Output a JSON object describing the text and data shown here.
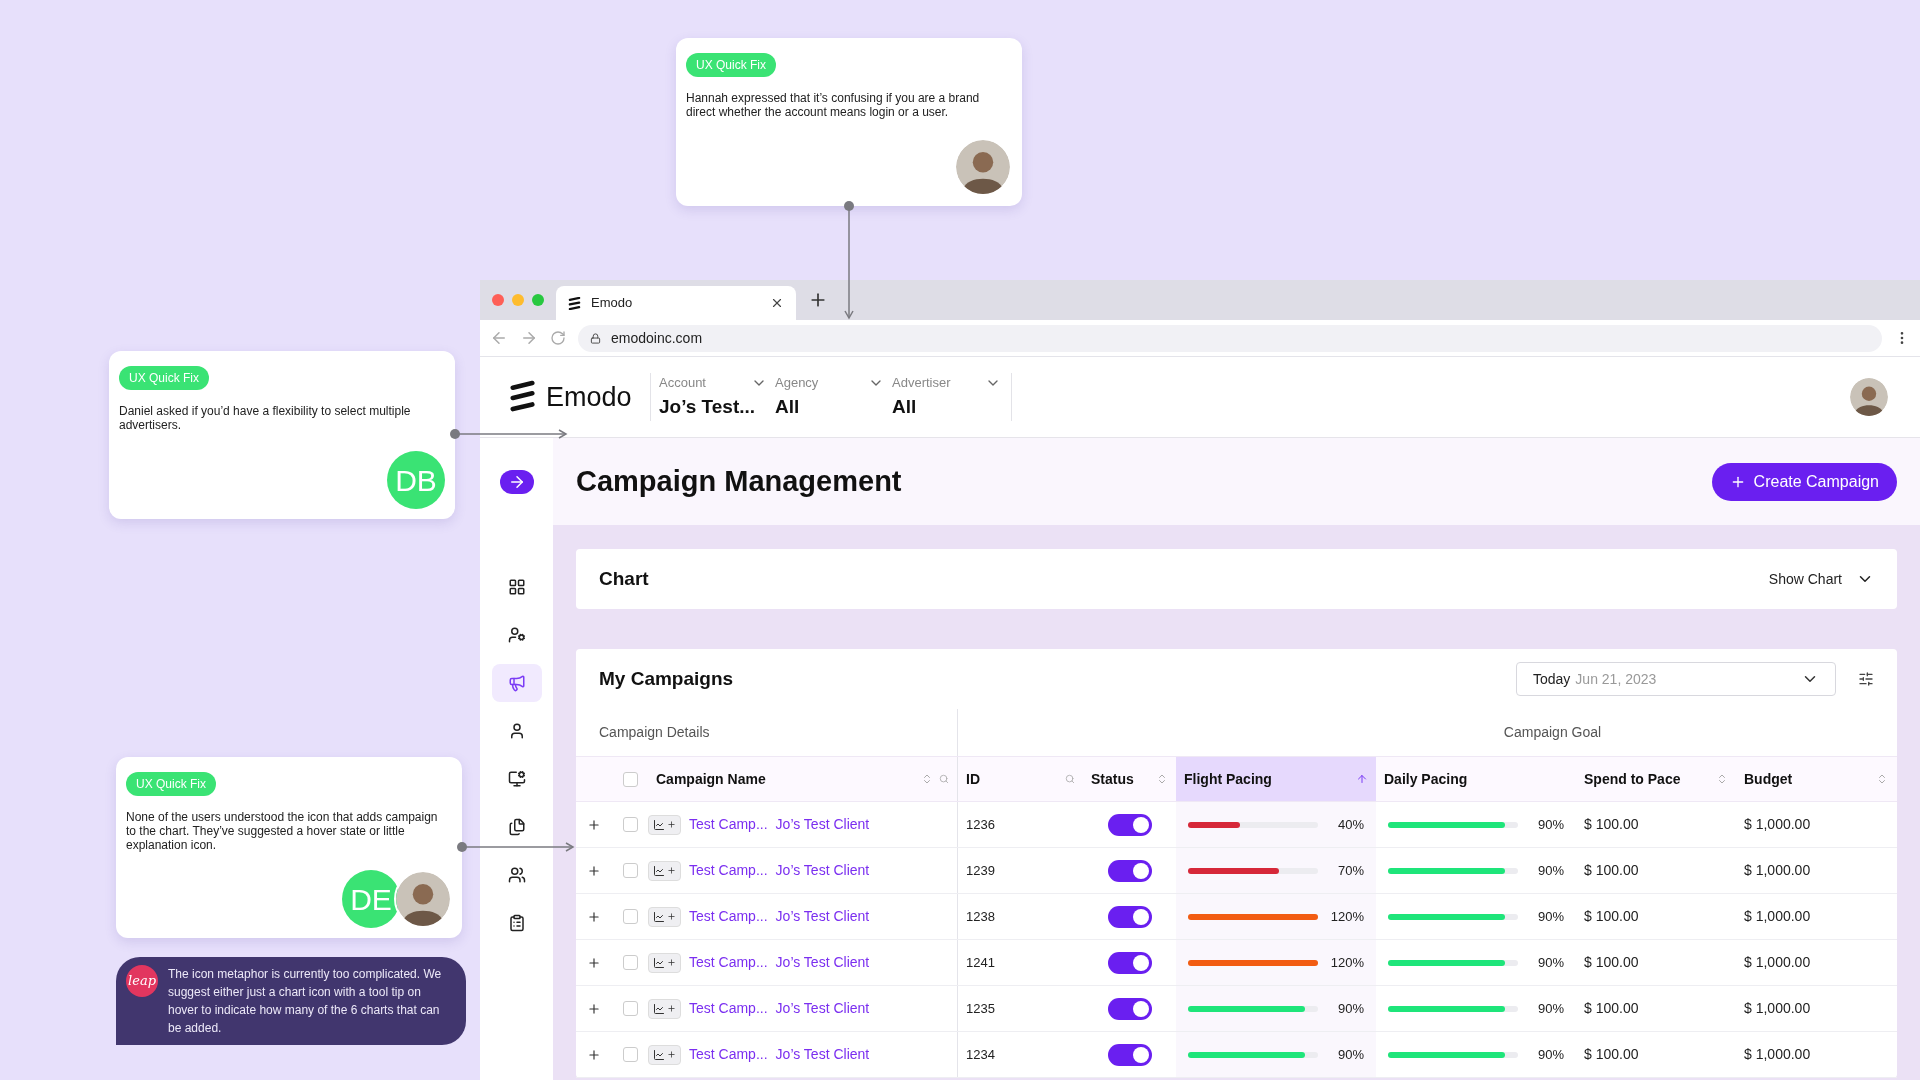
{
  "notes": [
    {
      "kind": "quick_fix",
      "tag": "UX Quick Fix",
      "text": "Hannah expressed that it’s confusing if you are a brand direct whether the account means login or a user.",
      "avatars": [
        {
          "kind": "photo"
        }
      ]
    },
    {
      "kind": "quick_fix",
      "tag": "UX Quick Fix",
      "text": "Daniel asked if you’d have a flexibility to select multiple advertisers.",
      "avatars": [
        {
          "kind": "initials",
          "text": "DB"
        }
      ]
    },
    {
      "kind": "quick_fix",
      "tag": "UX Quick Fix",
      "text": "None of the users understood the icon that adds campaign to the chart. They’ve suggested a hover state or little explanation icon.",
      "avatars": [
        {
          "kind": "initials",
          "text": "DE"
        },
        {
          "kind": "photo"
        }
      ]
    },
    {
      "kind": "agency_note",
      "logo_text": "leap",
      "text": "The icon metaphor is currently too complicated. We suggest either just a chart icon with a tool tip on hover to indicate how many of the 6 charts that can be added."
    }
  ],
  "browser": {
    "tab_title": "Emodo",
    "url": "emodoinc.com"
  },
  "app": {
    "logo_text": "Emodo",
    "filters": [
      {
        "label": "Account",
        "value": "Jo’s Test..."
      },
      {
        "label": "Agency",
        "value": "All"
      },
      {
        "label": "Advertiser",
        "value": "All"
      }
    ],
    "sidebar": {
      "items": [
        {
          "selected": false
        },
        {
          "selected": false
        },
        {
          "selected": true
        },
        {
          "selected": false
        },
        {
          "selected": false
        },
        {
          "selected": false
        },
        {
          "selected": false
        },
        {
          "selected": false
        }
      ]
    },
    "page_title": "Campaign Management",
    "create_button": "Create Campaign",
    "chart_panel": {
      "title": "Chart",
      "toggle_label": "Show Chart"
    },
    "campaigns": {
      "title": "My Campaigns",
      "all_checked": false,
      "date_label": "Today",
      "date_value": "Jun 21, 2023",
      "groups": [
        "Campaign Details",
        "Campaign Goal"
      ],
      "columns": [
        {
          "label": "Campaign Name",
          "sortable": true,
          "searchable": true,
          "selected": false
        },
        {
          "label": "ID",
          "sortable": false,
          "searchable": true,
          "selected": false
        },
        {
          "label": "Status",
          "sortable": true,
          "searchable": false,
          "selected": false
        },
        {
          "label": "Flight Pacing",
          "sortable": true,
          "searchable": false,
          "selected": true
        },
        {
          "label": "Daily Pacing",
          "sortable": false,
          "searchable": false,
          "selected": false
        },
        {
          "label": "Spend to Pace",
          "sortable": true,
          "searchable": false,
          "selected": false
        },
        {
          "label": "Budget",
          "sortable": true,
          "searchable": false,
          "selected": false
        }
      ],
      "rows": [
        {
          "checked": false,
          "name": "Test Camp...",
          "client": "Jo’s Test Client",
          "id": "1236",
          "on": true,
          "flight": {
            "level": 0.4,
            "reading": "40%",
            "color": "#d62839"
          },
          "daily": {
            "level": 0.9,
            "reading": "90%",
            "color": "#1ee57a"
          },
          "spend": "$ 100.00",
          "budget": "$ 1,000.00"
        },
        {
          "checked": false,
          "name": "Test Camp...",
          "client": "Jo’s Test Client",
          "id": "1239",
          "on": true,
          "flight": {
            "level": 0.7,
            "reading": "70%",
            "color": "#d62839"
          },
          "daily": {
            "level": 0.9,
            "reading": "90%",
            "color": "#1ee57a"
          },
          "spend": "$ 100.00",
          "budget": "$ 1,000.00"
        },
        {
          "checked": false,
          "name": "Test Camp...",
          "client": "Jo’s Test Client",
          "id": "1238",
          "on": true,
          "flight": {
            "level": 1,
            "reading": "120%",
            "color": "#f25c12"
          },
          "daily": {
            "level": 0.9,
            "reading": "90%",
            "color": "#1ee57a"
          },
          "spend": "$ 100.00",
          "budget": "$ 1,000.00"
        },
        {
          "checked": false,
          "name": "Test Camp...",
          "client": "Jo’s Test Client",
          "id": "1241",
          "on": true,
          "flight": {
            "level": 1,
            "reading": "120%",
            "color": "#f25c12"
          },
          "daily": {
            "level": 0.9,
            "reading": "90%",
            "color": "#1ee57a"
          },
          "spend": "$ 100.00",
          "budget": "$ 1,000.00"
        },
        {
          "checked": false,
          "name": "Test Camp...",
          "client": "Jo’s Test Client",
          "id": "1235",
          "on": true,
          "flight": {
            "level": 0.9,
            "reading": "90%",
            "color": "#1ee57a"
          },
          "daily": {
            "level": 0.9,
            "reading": "90%",
            "color": "#1ee57a"
          },
          "spend": "$ 100.00",
          "budget": "$ 1,000.00"
        },
        {
          "checked": false,
          "name": "Test Camp...",
          "client": "Jo’s Test Client",
          "id": "1234",
          "on": true,
          "flight": {
            "level": 0.9,
            "reading": "90%",
            "color": "#1ee57a"
          },
          "daily": {
            "level": 0.9,
            "reading": "90%",
            "color": "#1ee57a"
          },
          "spend": "$ 100.00",
          "budget": "$ 1,000.00"
        }
      ]
    }
  }
}
